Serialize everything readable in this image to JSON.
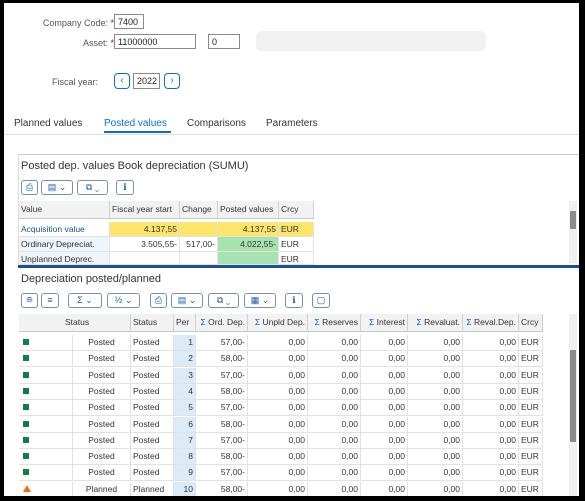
{
  "header": {
    "company_code_label": "Company Code:",
    "company_code_value": "7400",
    "asset_label": "Asset:",
    "asset_value": "11000000",
    "asset_sub_value": "0",
    "required_mark": "*",
    "fiscal_year_label": "Fiscal year:",
    "fiscal_year_value": "2022"
  },
  "tabs": [
    "Planned values",
    "Posted values",
    "Comparisons",
    "Parameters"
  ],
  "active_tab": "Posted values",
  "panel1": {
    "title": "Posted dep. values Book depreciation (SUMU)",
    "columns": [
      "Value",
      "Fiscal year start",
      "Change",
      "Posted values",
      "Crcy"
    ],
    "rows": [
      {
        "value": "Acquisition value",
        "fy_start": "4.137,55",
        "change": "",
        "posted": "4.137,55",
        "crcy": "EUR"
      },
      {
        "value": "Ordinary Depreciat.",
        "fy_start": "3.505,55-",
        "change": "517,00-",
        "posted": "4.022,55-",
        "crcy": "EUR"
      },
      {
        "value": "Unplanned Deprec.",
        "fy_start": "",
        "change": "",
        "posted": "",
        "crcy": "EUR"
      }
    ]
  },
  "panel2": {
    "title": "Depreciation posted/planned",
    "columns": [
      "Status",
      "Status",
      "Per",
      "Ord. Dep.",
      "Unpld Dep.",
      "Reserves",
      "Interest",
      "Revaluat.",
      "Reval.Dep.",
      "Crcy"
    ],
    "rows": [
      {
        "icon": "green",
        "status1": "Posted",
        "status2": "Posted",
        "per": "1",
        "ord": "57,00-",
        "unpl": "0,00",
        "res": "0,00",
        "int": "0,00",
        "reval": "0,00",
        "revdep": "0,00",
        "crcy": "EUR"
      },
      {
        "icon": "green",
        "status1": "Posted",
        "status2": "Posted",
        "per": "2",
        "ord": "58,00-",
        "unpl": "0,00",
        "res": "0,00",
        "int": "0,00",
        "reval": "0,00",
        "revdep": "0,00",
        "crcy": "EUR"
      },
      {
        "icon": "green",
        "status1": "Posted",
        "status2": "Posted",
        "per": "3",
        "ord": "57,00-",
        "unpl": "0,00",
        "res": "0,00",
        "int": "0,00",
        "reval": "0,00",
        "revdep": "0,00",
        "crcy": "EUR"
      },
      {
        "icon": "green",
        "status1": "Posted",
        "status2": "Posted",
        "per": "4",
        "ord": "58,00-",
        "unpl": "0,00",
        "res": "0,00",
        "int": "0,00",
        "reval": "0,00",
        "revdep": "0,00",
        "crcy": "EUR"
      },
      {
        "icon": "green",
        "status1": "Posted",
        "status2": "Posted",
        "per": "5",
        "ord": "57,00-",
        "unpl": "0,00",
        "res": "0,00",
        "int": "0,00",
        "reval": "0,00",
        "revdep": "0,00",
        "crcy": "EUR"
      },
      {
        "icon": "green",
        "status1": "Posted",
        "status2": "Posted",
        "per": "6",
        "ord": "58,00-",
        "unpl": "0,00",
        "res": "0,00",
        "int": "0,00",
        "reval": "0,00",
        "revdep": "0,00",
        "crcy": "EUR"
      },
      {
        "icon": "green",
        "status1": "Posted",
        "status2": "Posted",
        "per": "7",
        "ord": "57,00-",
        "unpl": "0,00",
        "res": "0,00",
        "int": "0,00",
        "reval": "0,00",
        "revdep": "0,00",
        "crcy": "EUR"
      },
      {
        "icon": "green",
        "status1": "Posted",
        "status2": "Posted",
        "per": "8",
        "ord": "58,00-",
        "unpl": "0,00",
        "res": "0,00",
        "int": "0,00",
        "reval": "0,00",
        "revdep": "0,00",
        "crcy": "EUR"
      },
      {
        "icon": "green",
        "status1": "Posted",
        "status2": "Posted",
        "per": "9",
        "ord": "57,00-",
        "unpl": "0,00",
        "res": "0,00",
        "int": "0,00",
        "reval": "0,00",
        "revdep": "0,00",
        "crcy": "EUR"
      },
      {
        "icon": "orange",
        "status1": "Planned",
        "status2": "Planned",
        "per": "10",
        "ord": "58,00-",
        "unpl": "0,00",
        "res": "0,00",
        "int": "0,00",
        "reval": "0,00",
        "revdep": "0,00",
        "crcy": "EUR"
      }
    ]
  },
  "toolbar_icons": {
    "panel1": [
      "print-icon",
      "export-icon",
      "layout-icon",
      "details-icon"
    ],
    "panel2": [
      "sort-asc-icon",
      "filter-icon",
      "sum-icon",
      "subtotal-icon",
      "print-icon",
      "export-icon",
      "layout-icon",
      "graphic-icon",
      "details-icon",
      "window-icon"
    ]
  },
  "colors": {
    "accent": "#0a6ed1",
    "posted_green": "#107e3e",
    "planned_orange": "#e9730c",
    "highlight_yellow": "#fde46b",
    "highlight_green": "#a7e3b1",
    "per_column": "#dcebf8"
  }
}
